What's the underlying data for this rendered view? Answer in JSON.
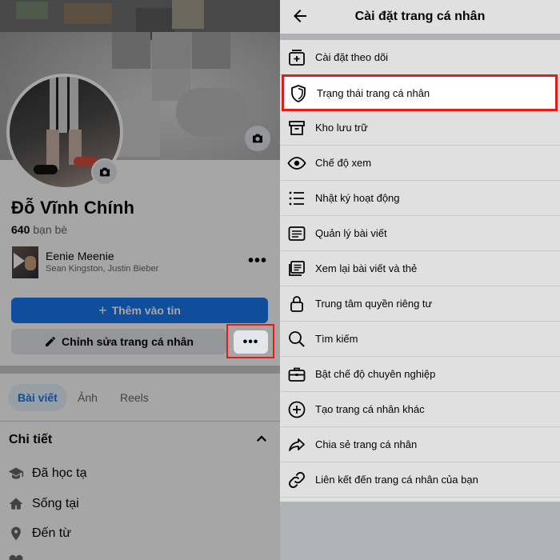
{
  "left": {
    "profile": {
      "name": "Đỗ Vĩnh Chính",
      "friend_count": "640",
      "friend_label": "bạn bè"
    },
    "music": {
      "title": "Eenie Meenie",
      "artist": "Sean Kingston, Justin Bieber"
    },
    "buttons": {
      "add_story": "Thêm vào tin",
      "edit_profile": "Chỉnh sửa trang cá nhân",
      "more": "•••"
    },
    "tabs": [
      "Bài viết",
      "Ảnh",
      "Reels"
    ],
    "details": {
      "title": "Chi tiết",
      "items": [
        "Đã học tạ",
        "Sống tại",
        "Đến từ"
      ]
    }
  },
  "right": {
    "header": {
      "title": "Cài đặt trang cá nhân"
    },
    "menu": [
      {
        "label": "Cài đặt theo dõi",
        "icon": "follow-settings-icon"
      },
      {
        "label": "Trạng thái trang cá nhân",
        "icon": "shield-icon"
      },
      {
        "label": "Kho lưu trữ",
        "icon": "archive-icon"
      },
      {
        "label": "Chế độ xem",
        "icon": "eye-icon"
      },
      {
        "label": "Nhật ký hoạt động",
        "icon": "activity-log-icon"
      },
      {
        "label": "Quản lý bài viết",
        "icon": "manage-posts-icon"
      },
      {
        "label": "Xem lại bài viết và thẻ",
        "icon": "review-posts-icon"
      },
      {
        "label": "Trung tâm quyền riêng tư",
        "icon": "lock-icon"
      },
      {
        "label": "Tìm kiếm",
        "icon": "search-icon"
      },
      {
        "label": "Bật chế độ chuyên nghiệp",
        "icon": "briefcase-icon"
      },
      {
        "label": "Tạo trang cá nhân khác",
        "icon": "plus-circle-icon"
      },
      {
        "label": "Chia sẻ trang cá nhân",
        "icon": "share-icon"
      },
      {
        "label": "Liên kết đến trang cá nhân của bạn",
        "icon": "link-icon"
      }
    ]
  },
  "colors": {
    "accent": "#1877f2",
    "highlight": "#e21b1b"
  }
}
